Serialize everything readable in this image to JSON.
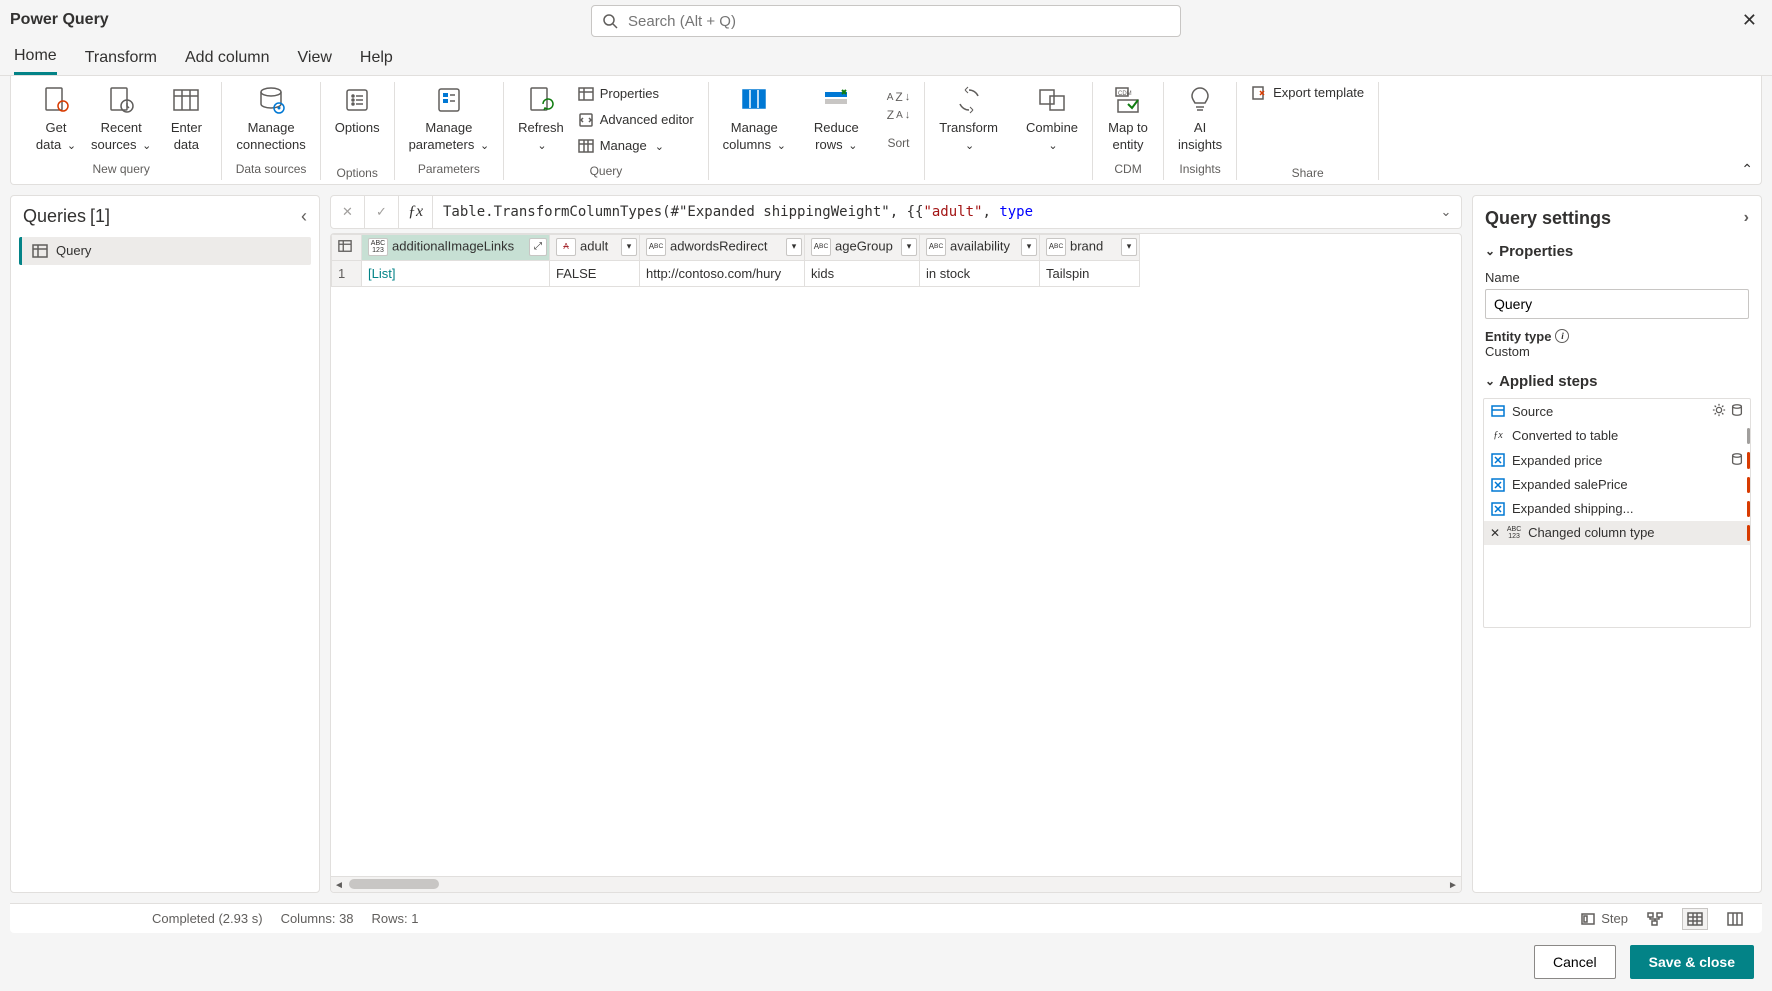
{
  "app": {
    "title": "Power Query"
  },
  "search": {
    "placeholder": "Search (Alt + Q)"
  },
  "tabs": [
    "Home",
    "Transform",
    "Add column",
    "View",
    "Help"
  ],
  "ribbon": {
    "getData": "Get\ndata",
    "recentSources": "Recent\nsources",
    "enterData": "Enter\ndata",
    "manageConnections": "Manage\nconnections",
    "options": "Options",
    "manageParameters": "Manage\nparameters",
    "refresh": "Refresh",
    "properties": "Properties",
    "advancedEditor": "Advanced editor",
    "manage": "Manage",
    "manageColumns": "Manage\ncolumns",
    "reduceRows": "Reduce\nrows",
    "transform": "Transform",
    "combine": "Combine",
    "mapToEntity": "Map to\nentity",
    "aiInsights": "AI\ninsights",
    "exportTemplate": "Export template",
    "groups": {
      "newQuery": "New query",
      "dataSources": "Data sources",
      "options": "Options",
      "parameters": "Parameters",
      "query": "Query",
      "sort": "Sort",
      "cdm": "CDM",
      "insights": "Insights",
      "share": "Share"
    }
  },
  "queriesPanel": {
    "title": "Queries",
    "count": "[1]",
    "items": [
      "Query"
    ]
  },
  "formula": {
    "prefix": "Table.TransformColumnTypes(#\"Expanded shippingWeight\", {{",
    "str": "\"adult\"",
    "sep": ", ",
    "kw": "type"
  },
  "grid": {
    "columns": [
      {
        "name": "additionalImageLinks",
        "type": "any",
        "selected": true,
        "expand": true
      },
      {
        "name": "adult",
        "type": "text-strike"
      },
      {
        "name": "adwordsRedirect",
        "type": "text"
      },
      {
        "name": "ageGroup",
        "type": "text"
      },
      {
        "name": "availability",
        "type": "text"
      },
      {
        "name": "brand",
        "type": "text"
      }
    ],
    "rows": [
      {
        "n": 1,
        "cells": [
          "[List]",
          "FALSE",
          "http://contoso.com/hury",
          "kids",
          "in stock",
          "Tailspin"
        ]
      }
    ]
  },
  "settings": {
    "title": "Query settings",
    "sections": {
      "properties": "Properties",
      "appliedSteps": "Applied steps"
    },
    "nameLabel": "Name",
    "nameValue": "Query",
    "entityTypeLabel": "Entity type",
    "entityTypeValue": "Custom",
    "steps": [
      {
        "label": "Source",
        "icon": "source",
        "gear": true
      },
      {
        "label": "Converted to table",
        "icon": "fx",
        "marker": "gray"
      },
      {
        "label": "Expanded price",
        "icon": "expand",
        "marker": "red",
        "db": true
      },
      {
        "label": "Expanded salePrice",
        "icon": "expand",
        "marker": "red"
      },
      {
        "label": "Expanded shipping...",
        "icon": "expand",
        "marker": "red"
      },
      {
        "label": "Changed column type",
        "icon": "type",
        "marker": "red",
        "selected": true,
        "delete": true
      }
    ]
  },
  "status": {
    "completed": "Completed (2.93 s)",
    "columns": "Columns: 38",
    "rows": "Rows: 1",
    "step": "Step"
  },
  "footer": {
    "cancel": "Cancel",
    "save": "Save & close"
  }
}
